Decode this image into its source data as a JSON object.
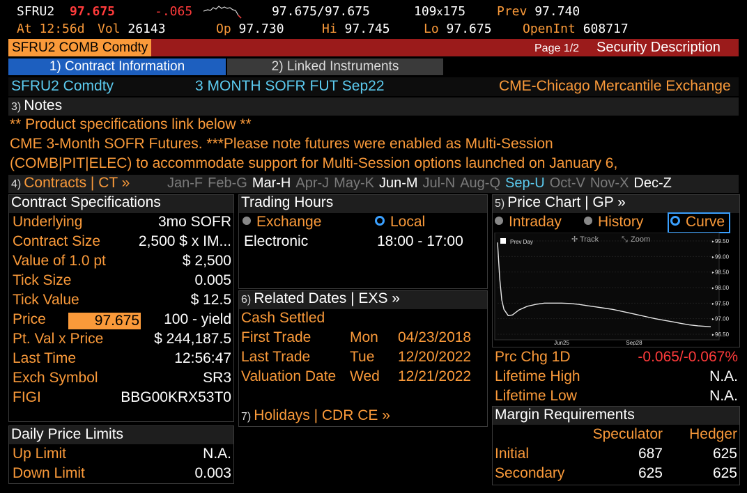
{
  "quote": {
    "ticker": "SFRU2",
    "last": "97.675",
    "change": "-.065",
    "bid_ask_label": "97.675",
    "bid_ask_sep": "/",
    "bid_ask_right": "97.675",
    "size_left": "109",
    "size_x": "x",
    "size_right": "175",
    "prev_label": "Prev",
    "prev_value": "97.740",
    "at_label": "At",
    "at_time": "12:56d",
    "vol_label": "Vol",
    "vol_value": "26143",
    "op_label": "Op",
    "op_value": "97.730",
    "hi_label": "Hi",
    "hi_value": "97.745",
    "lo_label": "Lo",
    "lo_value": "97.675",
    "oi_label": "OpenInt",
    "oi_value": "608717"
  },
  "titlebar": {
    "security": "SFRU2 COMB Comdty",
    "page": "Page 1/2",
    "screen": "Security Description"
  },
  "tabs": [
    {
      "label": "1) Contract Information"
    },
    {
      "label": "2) Linked Instruments"
    }
  ],
  "security_line": {
    "ticker": "SFRU2 Comdty",
    "name": "3 MONTH SOFR FUT  Sep22",
    "exchange": "CME-Chicago Mercantile Exchange"
  },
  "notes": {
    "num": "3)",
    "title": "Notes",
    "line1": "** Product specifications link below **",
    "line2": "CME 3-Month SOFR Futures.   ***Please note futures were enabled as Multi-Session",
    "line3": "(COMB|PIT|ELEC) to accommodate support for Multi-Session options launched on January 6,"
  },
  "contracts": {
    "num": "4)",
    "title": "Contracts | CT »",
    "months": [
      {
        "label": "Jan-F",
        "state": "dim"
      },
      {
        "label": "Feb-G",
        "state": "dim"
      },
      {
        "label": "Mar-H",
        "state": "on"
      },
      {
        "label": "Apr-J",
        "state": "dim"
      },
      {
        "label": "May-K",
        "state": "dim"
      },
      {
        "label": "Jun-M",
        "state": "on"
      },
      {
        "label": "Jul-N",
        "state": "dim"
      },
      {
        "label": "Aug-Q",
        "state": "dim"
      },
      {
        "label": "Sep-U",
        "state": "current"
      },
      {
        "label": "Oct-V",
        "state": "dim"
      },
      {
        "label": "Nov-X",
        "state": "dim"
      },
      {
        "label": "Dec-Z",
        "state": "on"
      }
    ]
  },
  "specs": {
    "title": "Contract Specifications",
    "rows": [
      {
        "label": "Underlying",
        "value": "3mo SOFR"
      },
      {
        "label": "Contract Size",
        "value": "2,500 $ x IM..."
      },
      {
        "label": "Value of 1.0 pt",
        "value": "$ 2,500"
      },
      {
        "label": "Tick Size",
        "value": "0.005"
      },
      {
        "label": "Tick Value",
        "value": "$ 12.5"
      },
      {
        "label": "Price",
        "value": "100 - yield",
        "input": "97.675"
      },
      {
        "label": "Pt. Val x Price",
        "value": "$ 244,187.5"
      },
      {
        "label": "Last Time",
        "value": "12:56:47"
      },
      {
        "label": "Exch Symbol",
        "value": "SR3"
      },
      {
        "label": "FIGI",
        "value": "BBG00KRX53T0"
      }
    ]
  },
  "limits": {
    "title": "Daily Price Limits",
    "rows": [
      {
        "label": "Up Limit",
        "value": "N.A."
      },
      {
        "label": "Down Limit",
        "value": "0.003"
      }
    ]
  },
  "hours": {
    "title": "Trading Hours",
    "opt_exchange": "Exchange",
    "opt_local": "Local",
    "session_label": "Electronic",
    "session_value": "18:00 - 17:00"
  },
  "dates": {
    "num": "6)",
    "title": "Related Dates | EXS »",
    "cash": "Cash Settled",
    "rows": [
      {
        "label": "First Trade",
        "day": "Mon",
        "date": "04/23/2018"
      },
      {
        "label": "Last Trade",
        "day": "Tue",
        "date": "12/20/2022"
      },
      {
        "label": "Valuation Date",
        "day": "Wed",
        "date": "12/21/2022"
      }
    ],
    "holidays_num": "7)",
    "holidays": "Holidays | CDR CE »"
  },
  "chart": {
    "num": "5)",
    "title": "Price Chart | GP »",
    "opt_intraday": "Intraday",
    "opt_history": "History",
    "opt_curve": "Curve",
    "legend": "Prev Day",
    "track": "Track",
    "zoom": "Zoom"
  },
  "chart_data": {
    "type": "line",
    "series": [
      {
        "values_approx": true
      }
    ],
    "x_ticks": [
      "Jun25",
      "Sep28"
    ],
    "y_ticks": [
      "99.50",
      "99.00",
      "98.50",
      "98.00",
      "97.50",
      "97.00",
      "96.50"
    ],
    "ylim": [
      96.5,
      99.5
    ],
    "x": [
      0,
      1,
      2,
      3,
      5,
      7,
      10,
      14,
      18,
      22,
      26,
      30,
      34,
      38,
      42,
      46,
      50,
      54,
      58,
      62,
      66,
      70,
      74,
      78,
      82,
      86,
      90,
      94,
      98,
      100
    ],
    "y": [
      99.45,
      98.3,
      97.6,
      97.3,
      97.1,
      97.12,
      97.28,
      97.4,
      97.46,
      97.5,
      97.5,
      97.5,
      97.49,
      97.46,
      97.42,
      97.38,
      97.34,
      97.3,
      97.24,
      97.18,
      97.12,
      97.06,
      97.0,
      96.95,
      96.9,
      96.85,
      96.8,
      96.77,
      96.75,
      96.74
    ]
  },
  "stats": {
    "prc_chg_label": "Prc Chg 1D",
    "prc_chg_value": "-0.065/-0.067%",
    "hi_label": "Lifetime High",
    "hi_value": "N.A.",
    "lo_label": "Lifetime Low",
    "lo_value": "N.A."
  },
  "margin": {
    "title": "Margin Requirements",
    "col1": "Speculator",
    "col2": "Hedger",
    "rows": [
      {
        "label": "Initial",
        "spec": "687",
        "hedge": "625"
      },
      {
        "label": "Secondary",
        "spec": "625",
        "hedge": "625"
      }
    ]
  },
  "colors": {
    "accent_orange": "#fa9a3a",
    "title_bar_red": "#9b1b1b",
    "tab_active_blue": "#1d5fbf",
    "cyan": "#5ccbf0",
    "negative_red": "#ff3b3b"
  }
}
